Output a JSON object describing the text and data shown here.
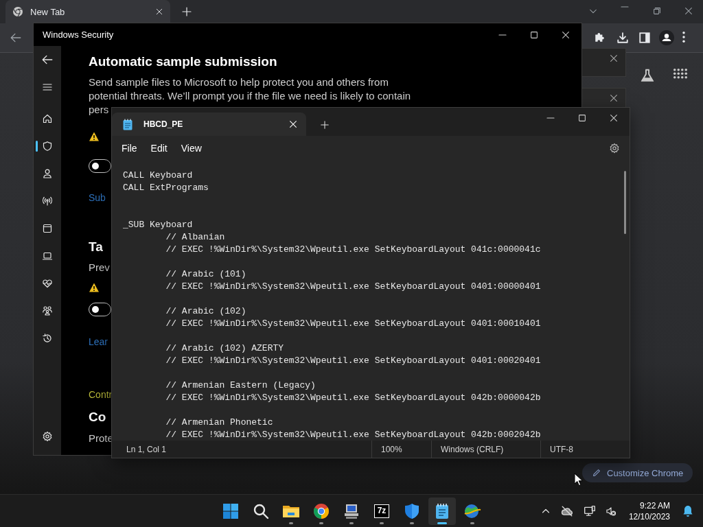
{
  "browser": {
    "tab": {
      "title": "New Tab",
      "selected": true
    },
    "customize_button": "Customize Chrome"
  },
  "security": {
    "title": "Windows Security",
    "nav": [
      {
        "kind": "home",
        "selected": false
      },
      {
        "kind": "shield",
        "selected": true
      },
      {
        "kind": "account",
        "selected": false
      },
      {
        "kind": "network",
        "selected": false
      },
      {
        "kind": "app",
        "selected": false
      },
      {
        "kind": "device",
        "selected": false
      },
      {
        "kind": "health",
        "selected": false
      },
      {
        "kind": "family",
        "selected": false
      },
      {
        "kind": "history",
        "selected": false
      }
    ],
    "content": [
      {
        "kind": "heading",
        "text": "Automatic sample submission"
      },
      {
        "kind": "paragraph",
        "lines": [
          "Send sample files to Microsoft to help protect you and others from",
          "potential threats. We’ll prompt you if the file we need is likely to contain",
          "pers"
        ]
      },
      {
        "kind": "warning"
      },
      {
        "kind": "toggle",
        "on": false
      },
      {
        "kind": "link",
        "text": "Sub"
      },
      {
        "kind": "heading",
        "text": "Ta"
      },
      {
        "kind": "text",
        "text": "Prev"
      },
      {
        "kind": "warning"
      },
      {
        "kind": "toggle",
        "on": false
      },
      {
        "kind": "link",
        "text": "Lear"
      },
      {
        "kind": "label",
        "text": "Contr"
      },
      {
        "kind": "heading",
        "text": "Co"
      },
      {
        "kind": "text",
        "text": "Prote"
      }
    ]
  },
  "notepad": {
    "tab": {
      "title": "HBCD_PE",
      "selected": true
    },
    "menu": [
      "File",
      "Edit",
      "View"
    ],
    "content": "CALL Keyboard\nCALL ExtPrograms\n\n\n_SUB Keyboard\n\t// Albanian\n\t// EXEC !%WinDir%\\System32\\Wpeutil.exe SetKeyboardLayout 041c:0000041c\n\n\t// Arabic (101)\n\t// EXEC !%WinDir%\\System32\\Wpeutil.exe SetKeyboardLayout 0401:00000401\n\n\t// Arabic (102)\n\t// EXEC !%WinDir%\\System32\\Wpeutil.exe SetKeyboardLayout 0401:00010401\n\n\t// Arabic (102) AZERTY\n\t// EXEC !%WinDir%\\System32\\Wpeutil.exe SetKeyboardLayout 0401:00020401\n\n\t// Armenian Eastern (Legacy)\n\t// EXEC !%WinDir%\\System32\\Wpeutil.exe SetKeyboardLayout 042b:0000042b\n\n\t// Armenian Phonetic\n\t// EXEC !%WinDir%\\System32\\Wpeutil.exe SetKeyboardLayout 042b:0002042b",
    "status": {
      "position": "Ln 1, Col 1",
      "zoom": "100%",
      "line_ending": "Windows (CRLF)",
      "encoding": "UTF-8"
    }
  },
  "taskbar": {
    "apps": [
      {
        "kind": "start",
        "running": false,
        "selected": false
      },
      {
        "kind": "search",
        "running": false,
        "selected": false
      },
      {
        "kind": "folder",
        "running": true,
        "selected": false
      },
      {
        "kind": "browser",
        "running": true,
        "selected": false
      },
      {
        "kind": "computer",
        "running": true,
        "selected": false
      },
      {
        "kind": "archiver",
        "label": "7z",
        "running": true,
        "selected": false
      },
      {
        "kind": "security",
        "running": true,
        "selected": false
      },
      {
        "kind": "notepad",
        "running": true,
        "selected": true
      },
      {
        "kind": "globe",
        "running": true,
        "selected": false
      }
    ],
    "clock": {
      "time": "9:22 AM",
      "date": "12/10/2023"
    }
  }
}
